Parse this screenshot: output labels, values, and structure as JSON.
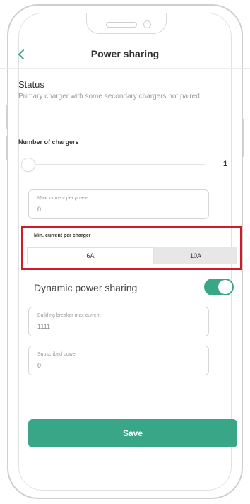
{
  "header": {
    "back_icon": "chevron-left-icon",
    "title": "Power sharing"
  },
  "status": {
    "title": "Status",
    "description": "Primary charger with some secondary chargers not paired"
  },
  "chargers": {
    "label": "Number of chargers",
    "value": "1"
  },
  "max_current": {
    "label": "Max. current per phase",
    "value": "0"
  },
  "min_current": {
    "label": "Min. current per charger",
    "options": [
      "6A",
      "10A"
    ],
    "selected": "10A"
  },
  "dynamic": {
    "label": "Dynamic power sharing",
    "enabled": true
  },
  "building_breaker": {
    "label": "Building breaker max current",
    "value": "1111"
  },
  "subscribed_power": {
    "label": "Subscribed power",
    "value": "0"
  },
  "save_label": "Save",
  "colors": {
    "accent": "#3aa688",
    "highlight": "#d11a2a"
  }
}
